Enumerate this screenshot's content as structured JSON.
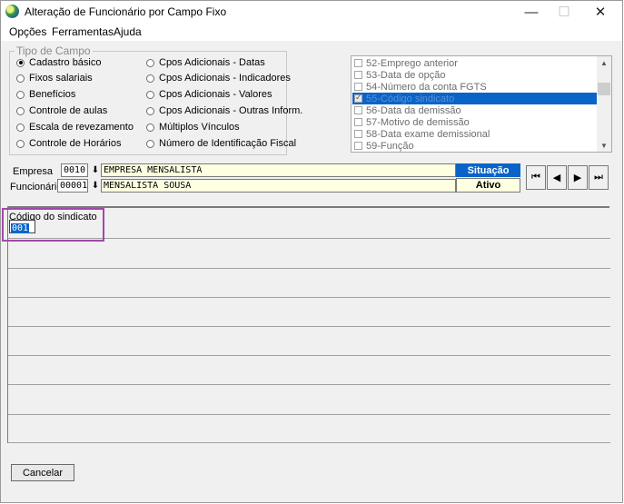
{
  "window": {
    "title": "Alteração de Funcionário por Campo Fixo",
    "controls": {
      "minimize": "—",
      "maximize": "☐",
      "close": "✕"
    }
  },
  "menu": [
    "Opções",
    "Ferramentas",
    "Ajuda"
  ],
  "tipo_campo": {
    "title": "Tipo de Campo",
    "options": [
      {
        "label": "Cadastro básico",
        "selected": true
      },
      {
        "label": "Fixos salariais",
        "selected": false
      },
      {
        "label": "Benefícios",
        "selected": false
      },
      {
        "label": "Controle de aulas",
        "selected": false
      },
      {
        "label": "Escala de revezamento",
        "selected": false
      },
      {
        "label": "Controle de Horários",
        "selected": false
      },
      {
        "label": "Cpos Adicionais - Datas",
        "selected": false
      },
      {
        "label": "Cpos Adicionais - Indicadores",
        "selected": false
      },
      {
        "label": "Cpos Adicionais - Valores",
        "selected": false
      },
      {
        "label": "Cpos Adicionais - Outras Inform.",
        "selected": false
      },
      {
        "label": "Múltiplos Vínculos",
        "selected": false
      },
      {
        "label": "Número de Identificação Fiscal",
        "selected": false
      }
    ]
  },
  "field_list": {
    "items": [
      {
        "label": "52-Emprego anterior",
        "checked": false,
        "selected": false
      },
      {
        "label": "53-Data de opção",
        "checked": false,
        "selected": false
      },
      {
        "label": "54-Número da conta FGTS",
        "checked": false,
        "selected": false
      },
      {
        "label": "55-Código sindicato",
        "checked": true,
        "selected": true
      },
      {
        "label": "56-Data da demissão",
        "checked": false,
        "selected": false
      },
      {
        "label": "57-Motivo de demissão",
        "checked": false,
        "selected": false
      },
      {
        "label": "58-Data exame demissional",
        "checked": false,
        "selected": false
      },
      {
        "label": "59-Função",
        "checked": false,
        "selected": false
      }
    ]
  },
  "empresa": {
    "label": "Empresa",
    "code": "0010",
    "name": "EMPRESA MENSALISTA"
  },
  "funcionario": {
    "label": "Funcionário",
    "code": "00001",
    "name": "MENSALISTA SOUSA"
  },
  "situacao": {
    "label": "Situação",
    "value": "Ativo"
  },
  "navigation": {
    "first": "⏮",
    "prev": "◀",
    "next": "▶",
    "last": "⏭"
  },
  "edit_field": {
    "label": "Código do sindicato",
    "value": "001"
  },
  "buttons": {
    "cancel": "Cancelar"
  },
  "colors": {
    "selection": "#0a64c8",
    "readonly_bg": "#ffffe1",
    "highlight_border": "#a14aa8"
  }
}
